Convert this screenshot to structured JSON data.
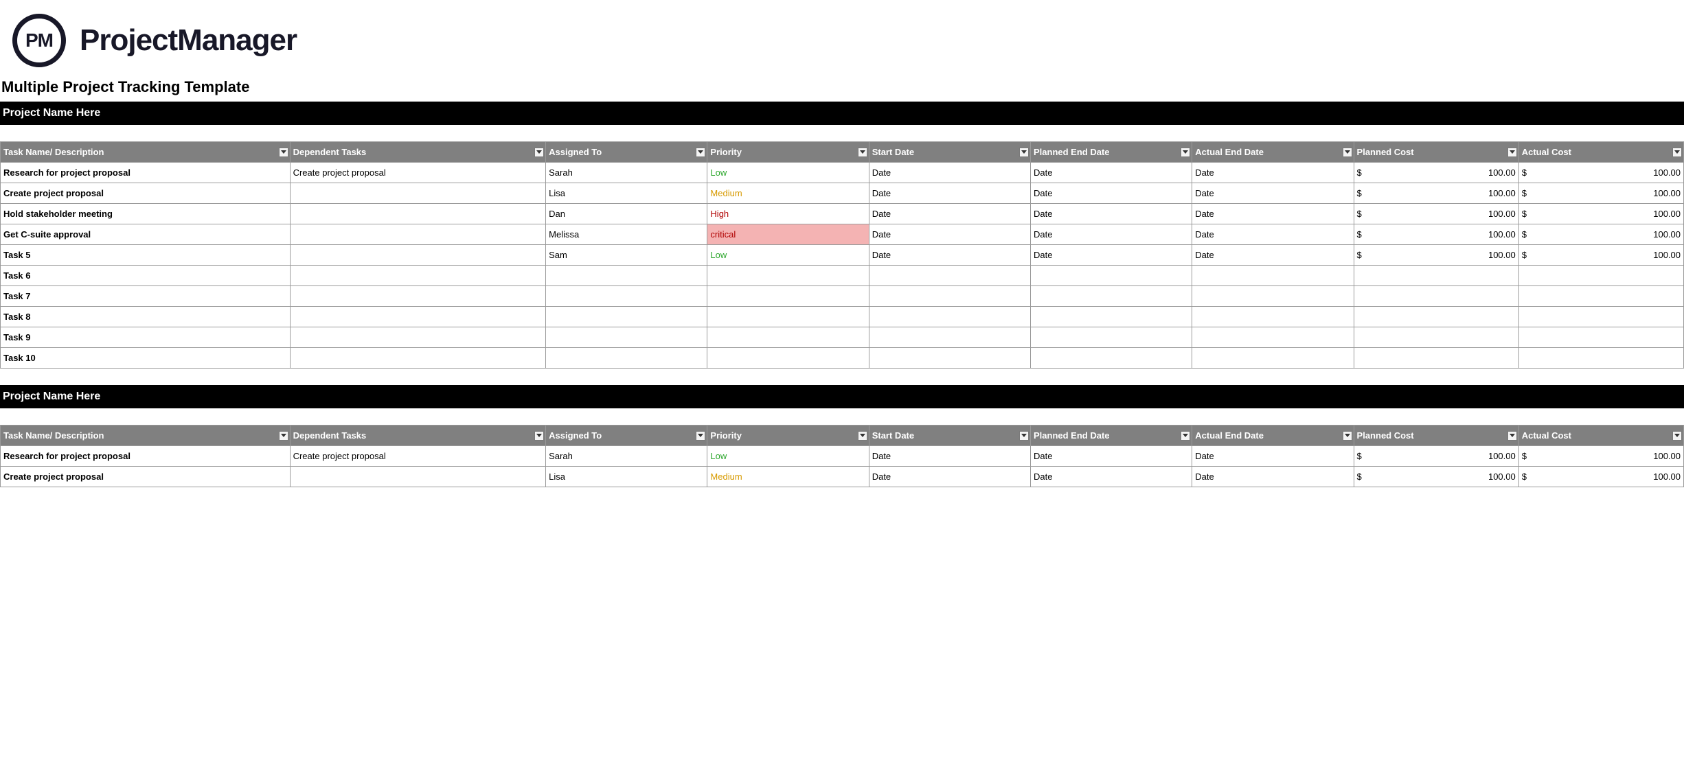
{
  "brand": {
    "logo_text": "PM",
    "name": "ProjectManager"
  },
  "template_title": "Multiple Project Tracking Template",
  "columns": {
    "task": "Task Name/ Description",
    "dependent": "Dependent Tasks",
    "assigned": "Assigned To",
    "priority": "Priority",
    "start": "Start Date",
    "planned_end": "Planned End Date",
    "actual_end": "Actual End Date",
    "planned_cost": "Planned Cost",
    "actual_cost": "Actual Cost"
  },
  "currency": "$",
  "projects": [
    {
      "name": "Project Name Here",
      "rows": [
        {
          "task": "Research for project proposal",
          "dependent": "Create project proposal",
          "assigned": "Sarah",
          "priority": "Low",
          "start": "Date",
          "planned_end": "Date",
          "actual_end": "Date",
          "planned_cost": "100.00",
          "actual_cost": "100.00"
        },
        {
          "task": "Create project proposal",
          "dependent": "",
          "assigned": "Lisa",
          "priority": "Medium",
          "start": "Date",
          "planned_end": "Date",
          "actual_end": "Date",
          "planned_cost": "100.00",
          "actual_cost": "100.00"
        },
        {
          "task": "Hold stakeholder meeting",
          "dependent": "",
          "assigned": "Dan",
          "priority": "High",
          "start": "Date",
          "planned_end": "Date",
          "actual_end": "Date",
          "planned_cost": "100.00",
          "actual_cost": "100.00"
        },
        {
          "task": "Get C-suite approval",
          "dependent": "",
          "assigned": "Melissa",
          "priority": "critical",
          "start": "Date",
          "planned_end": "Date",
          "actual_end": "Date",
          "planned_cost": "100.00",
          "actual_cost": "100.00"
        },
        {
          "task": "Task 5",
          "dependent": "",
          "assigned": "Sam",
          "priority": "Low",
          "start": "Date",
          "planned_end": "Date",
          "actual_end": "Date",
          "planned_cost": "100.00",
          "actual_cost": "100.00"
        },
        {
          "task": "Task 6",
          "dependent": "",
          "assigned": "",
          "priority": "",
          "start": "",
          "planned_end": "",
          "actual_end": "",
          "planned_cost": "",
          "actual_cost": ""
        },
        {
          "task": "Task 7",
          "dependent": "",
          "assigned": "",
          "priority": "",
          "start": "",
          "planned_end": "",
          "actual_end": "",
          "planned_cost": "",
          "actual_cost": ""
        },
        {
          "task": "Task 8",
          "dependent": "",
          "assigned": "",
          "priority": "",
          "start": "",
          "planned_end": "",
          "actual_end": "",
          "planned_cost": "",
          "actual_cost": ""
        },
        {
          "task": "Task 9",
          "dependent": "",
          "assigned": "",
          "priority": "",
          "start": "",
          "planned_end": "",
          "actual_end": "",
          "planned_cost": "",
          "actual_cost": ""
        },
        {
          "task": "Task 10",
          "dependent": "",
          "assigned": "",
          "priority": "",
          "start": "",
          "planned_end": "",
          "actual_end": "",
          "planned_cost": "",
          "actual_cost": ""
        }
      ]
    },
    {
      "name": "Project Name Here",
      "rows": [
        {
          "task": "Research for project proposal",
          "dependent": "Create project proposal",
          "assigned": "Sarah",
          "priority": "Low",
          "start": "Date",
          "planned_end": "Date",
          "actual_end": "Date",
          "planned_cost": "100.00",
          "actual_cost": "100.00"
        },
        {
          "task": "Create project proposal",
          "dependent": "",
          "assigned": "Lisa",
          "priority": "Medium",
          "start": "Date",
          "planned_end": "Date",
          "actual_end": "Date",
          "planned_cost": "100.00",
          "actual_cost": "100.00"
        }
      ]
    }
  ]
}
